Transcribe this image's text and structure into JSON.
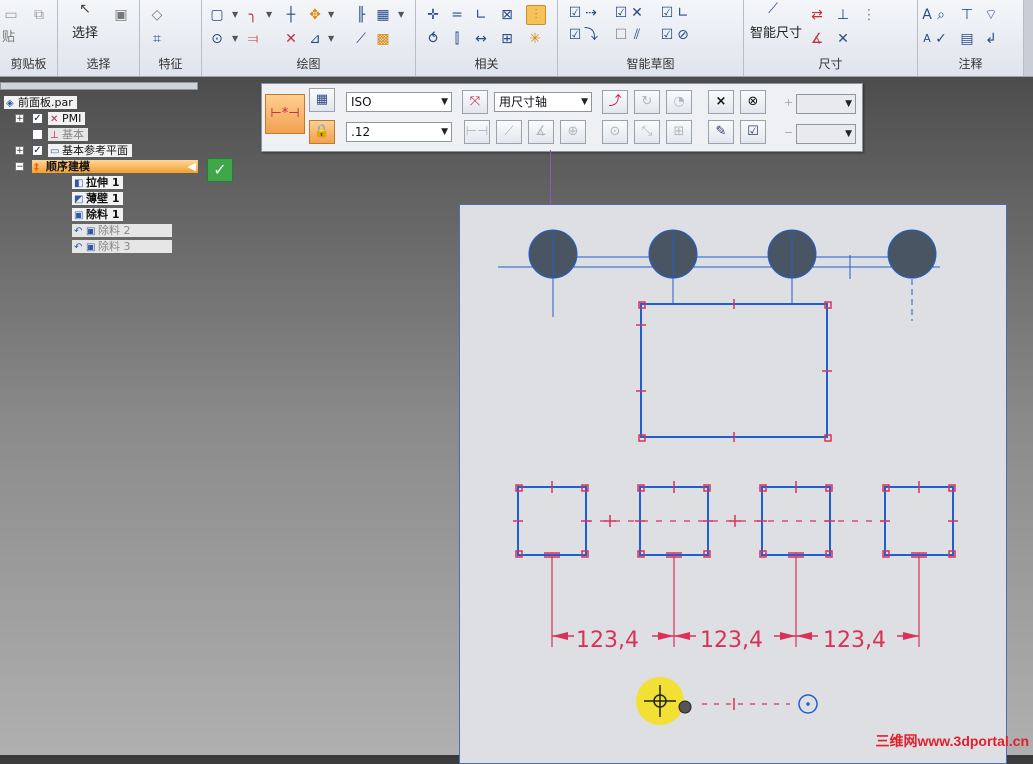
{
  "ribbon": {
    "groups": [
      {
        "id": "clipboard",
        "label": "剪贴板",
        "items": [
          "贴"
        ]
      },
      {
        "id": "select",
        "label": "选择",
        "items": [
          "选择"
        ]
      },
      {
        "id": "features",
        "label": "特征"
      },
      {
        "id": "draw",
        "label": "绘图"
      },
      {
        "id": "relate",
        "label": "相关"
      },
      {
        "id": "smart_sketch",
        "label": "智能草图"
      },
      {
        "id": "dimension",
        "label": "尺寸",
        "items": [
          "智能尺寸"
        ]
      },
      {
        "id": "annotation",
        "label": "注释"
      }
    ]
  },
  "dim_toolbar": {
    "standard": "ISO",
    "precision": ".12",
    "orientation": "用尺寸轴",
    "close_symbol": "×"
  },
  "tree": {
    "root": "前面板.par",
    "pmi": "PMI",
    "base": "基本",
    "base_ref_planes": "基本参考平面",
    "ordered_modeling": "顺序建模",
    "features": [
      {
        "label": "拉伸 1",
        "state": "active"
      },
      {
        "label": "薄壁 1",
        "state": "active"
      },
      {
        "label": "除料 1",
        "state": "active"
      },
      {
        "label": "除料 2",
        "state": "rolled"
      },
      {
        "label": "除料 3",
        "state": "rolled"
      }
    ]
  },
  "sketch": {
    "dimensions": [
      "123,4",
      "123,4",
      "123,4"
    ],
    "colors": {
      "profile": "#1f5fd0",
      "relation": "#d8325a",
      "circle_fill": "#4a5564"
    }
  },
  "watermark": "三维网www.3dportal.cn"
}
